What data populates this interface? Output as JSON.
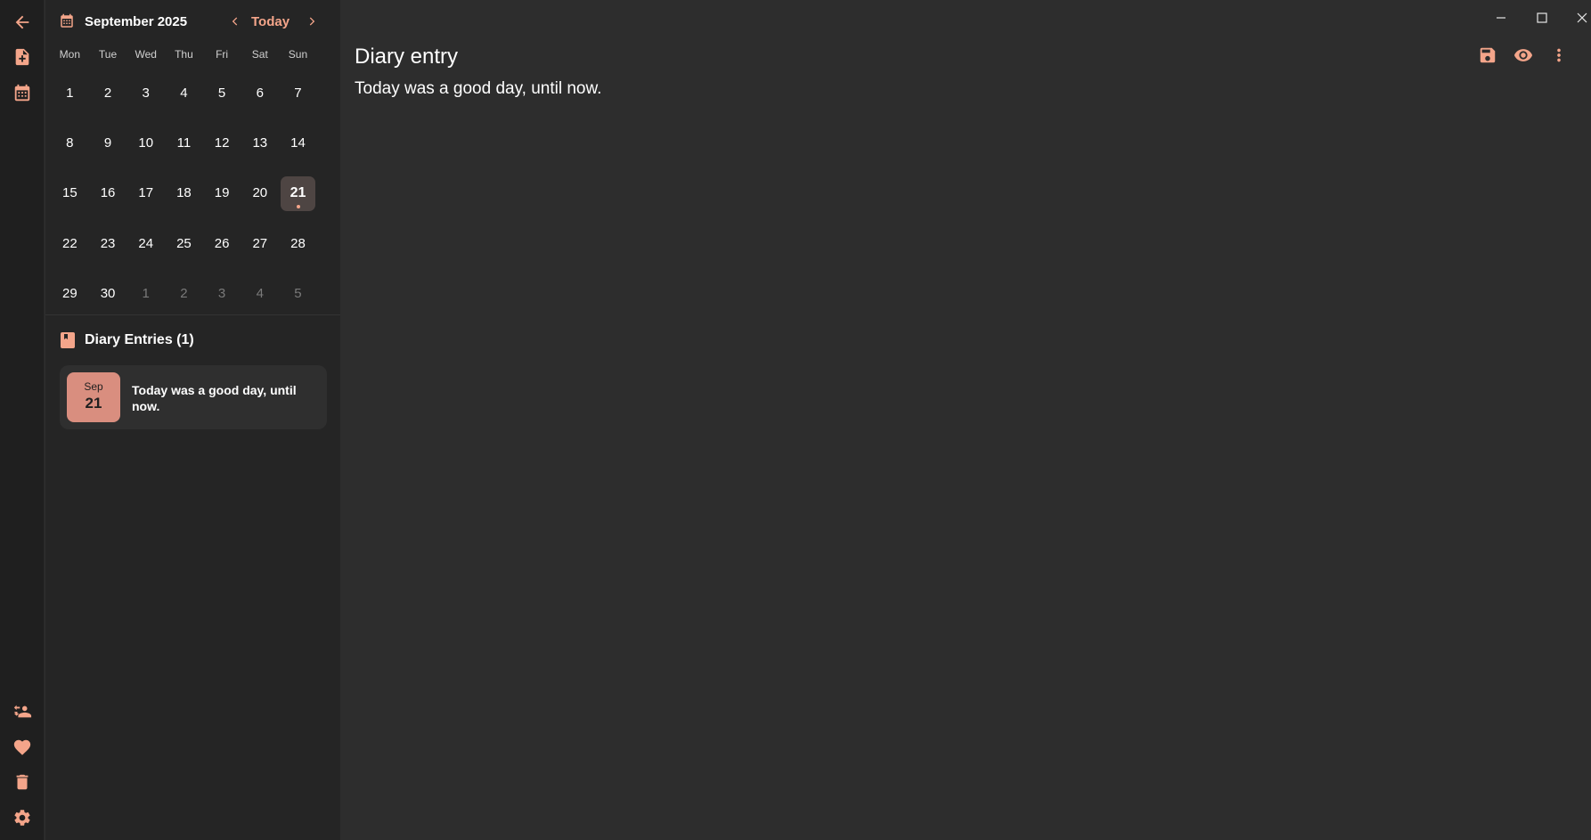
{
  "rail": {
    "top": [
      {
        "name": "back-icon"
      },
      {
        "name": "new-document-icon"
      },
      {
        "name": "calendar-icon"
      }
    ],
    "bottom": [
      {
        "name": "switch-user-icon"
      },
      {
        "name": "heart-icon"
      },
      {
        "name": "trash-icon"
      },
      {
        "name": "settings-gear-icon"
      }
    ]
  },
  "calendar": {
    "month_title": "September 2025",
    "today_label": "Today",
    "weekdays": [
      "Mon",
      "Tue",
      "Wed",
      "Thu",
      "Fri",
      "Sat",
      "Sun"
    ],
    "days": [
      {
        "label": "1",
        "current": true
      },
      {
        "label": "2",
        "current": true
      },
      {
        "label": "3",
        "current": true
      },
      {
        "label": "4",
        "current": true
      },
      {
        "label": "5",
        "current": true
      },
      {
        "label": "6",
        "current": true
      },
      {
        "label": "7",
        "current": true
      },
      {
        "label": "8",
        "current": true
      },
      {
        "label": "9",
        "current": true
      },
      {
        "label": "10",
        "current": true
      },
      {
        "label": "11",
        "current": true
      },
      {
        "label": "12",
        "current": true
      },
      {
        "label": "13",
        "current": true
      },
      {
        "label": "14",
        "current": true
      },
      {
        "label": "15",
        "current": true
      },
      {
        "label": "16",
        "current": true
      },
      {
        "label": "17",
        "current": true
      },
      {
        "label": "18",
        "current": true
      },
      {
        "label": "19",
        "current": true
      },
      {
        "label": "20",
        "current": true
      },
      {
        "label": "21",
        "current": true,
        "selected": true,
        "has_entry": true
      },
      {
        "label": "22",
        "current": true
      },
      {
        "label": "23",
        "current": true
      },
      {
        "label": "24",
        "current": true
      },
      {
        "label": "25",
        "current": true
      },
      {
        "label": "26",
        "current": true
      },
      {
        "label": "27",
        "current": true
      },
      {
        "label": "28",
        "current": true
      },
      {
        "label": "29",
        "current": true
      },
      {
        "label": "30",
        "current": true
      },
      {
        "label": "1",
        "current": false
      },
      {
        "label": "2",
        "current": false
      },
      {
        "label": "3",
        "current": false
      },
      {
        "label": "4",
        "current": false
      },
      {
        "label": "5",
        "current": false
      }
    ]
  },
  "entries": {
    "title": "Diary Entries (1)",
    "items": [
      {
        "month": "Sep",
        "day": "21",
        "text": "Today was a good day, until now."
      }
    ]
  },
  "editor": {
    "title": "Diary entry",
    "body": "Today was a good day, until now."
  },
  "colors": {
    "accent": "#f4a58a",
    "background": "#2d2d2d",
    "sidebar": "#252525",
    "rail": "#1f1f1f",
    "date_badge": "#d98e7f",
    "selected_day": "#4e4543"
  }
}
